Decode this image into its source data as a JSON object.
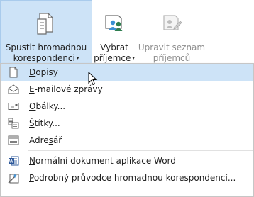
{
  "ribbon": {
    "merge_button": {
      "line1": "Spustit hromadnou",
      "line2": "korespondenci",
      "caret": "▾",
      "icon": "document-merge-icon"
    },
    "recipients_button": {
      "line1": "Vybrat",
      "line2": "příjemce",
      "caret": "▾",
      "icon": "people-icon"
    },
    "edit_recipients_button": {
      "line1": "Upravit seznam",
      "line2": "příjemců",
      "icon": "edit-recipient-list-icon",
      "disabled": true
    }
  },
  "menu": {
    "items": [
      {
        "label_prefix": "",
        "label_hotkey": "D",
        "label_rest": "opisy",
        "icon": "letter-icon",
        "highlighted": true
      },
      {
        "label_prefix": "",
        "label_hotkey": "E",
        "label_rest": "-mailové zprávy",
        "icon": "email-icon",
        "highlighted": false
      },
      {
        "label_prefix": "",
        "label_hotkey": "O",
        "label_rest": "bálky...",
        "icon": "envelope-icon",
        "highlighted": false
      },
      {
        "label_prefix": "",
        "label_hotkey": "Š",
        "label_rest": "títky...",
        "icon": "labels-icon",
        "highlighted": false
      },
      {
        "label_prefix": "Adre",
        "label_hotkey": "s",
        "label_rest": "ář",
        "icon": "directory-icon",
        "highlighted": false
      },
      {
        "label_prefix": "",
        "label_hotkey": "N",
        "label_rest": "ormální dokument aplikace Word",
        "icon": "word-icon",
        "highlighted": false
      },
      {
        "label_prefix": "",
        "label_hotkey": "P",
        "label_rest": "odrobný průvodce hromadnou korespondencí...",
        "icon": "wizard-icon",
        "highlighted": false
      }
    ]
  },
  "colors": {
    "highlight": "#cde3f7",
    "highlight_border": "#a9cbec",
    "word_blue": "#2b579a",
    "disabled_text": "#8f8f8f"
  }
}
